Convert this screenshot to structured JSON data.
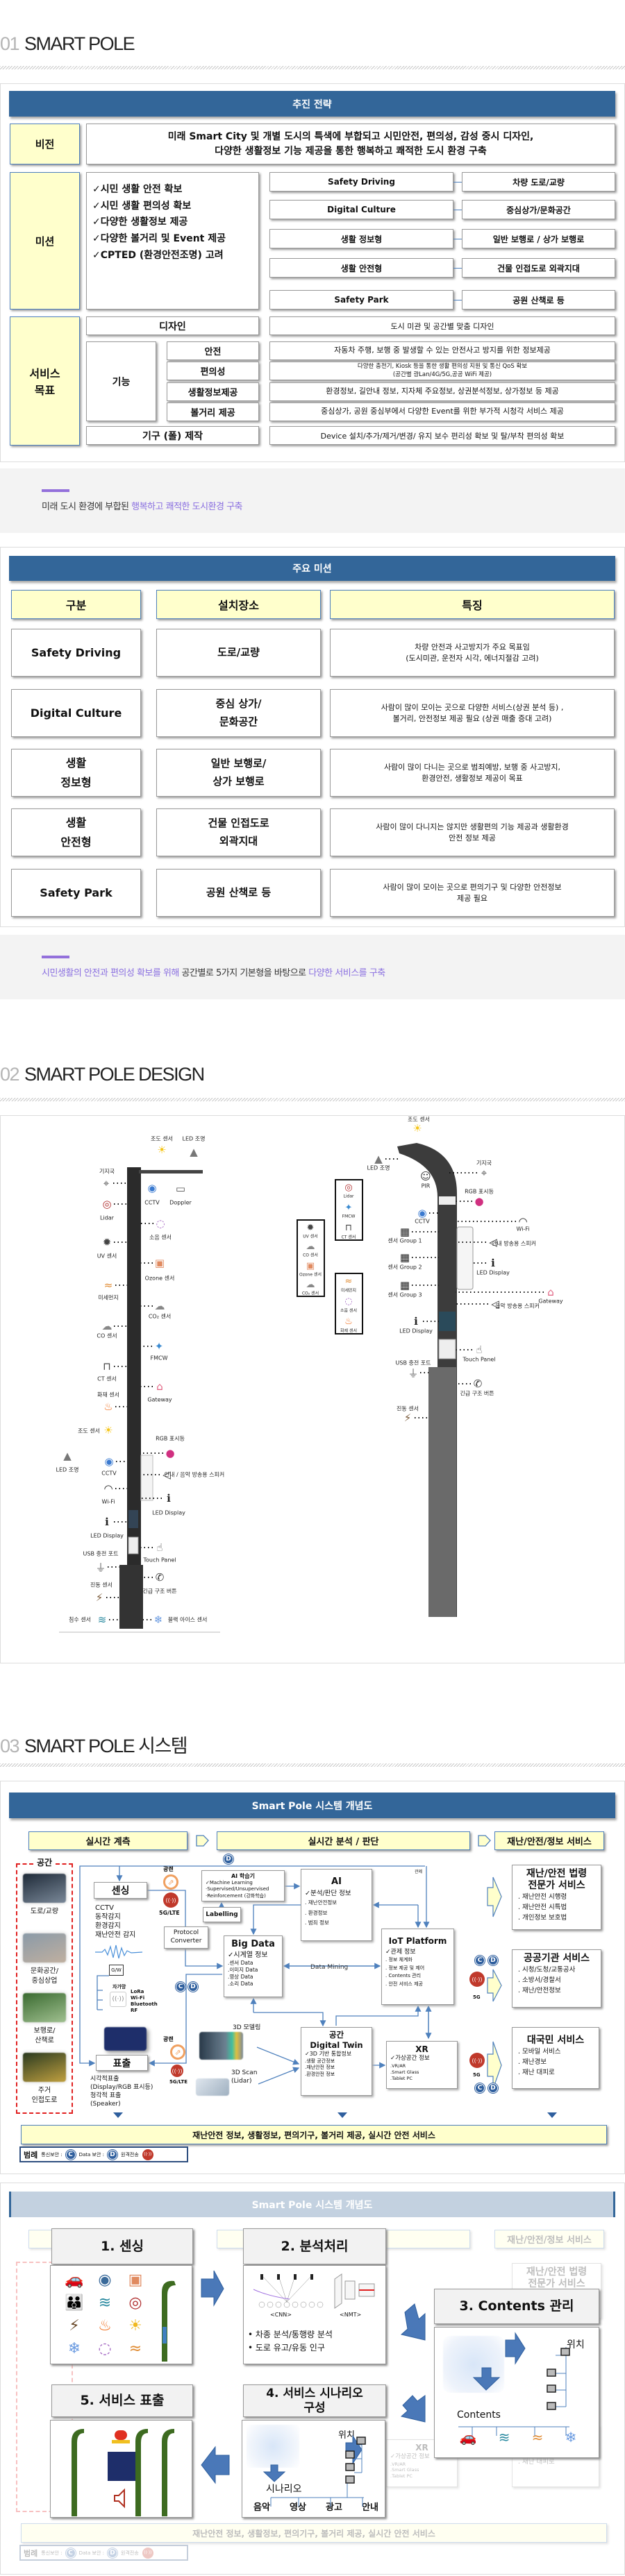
{
  "section1": {
    "num": "01",
    "title": "SMART POLE",
    "strategy": {
      "header": "추진 전략",
      "vision_label": "비전",
      "vision_text": "미래 Smart City 및 개별 도시의 특색에 부합되고 시민안전, 편의성,  감성 중시 디자인,\n다양한 생활정보 기능 제공을 통한 행복하고 쾌적한 도시 환경 구축",
      "mission_label": "미션",
      "mission_checks": [
        "✓시민 생활 안전 확보",
        "✓시민 생활 편의성 확보",
        "✓다양한 생활정보 제공",
        "✓다양한 볼거리 및 Event 제공",
        "✓CPTED (환경안전조명) 고려"
      ],
      "mission_types": [
        {
          "type": "Safety Driving",
          "place": "차량 도로/교량"
        },
        {
          "type": "Digital Culture",
          "place": "중심상가/문화공간"
        },
        {
          "type": "생활 정보형",
          "place": "일반 보행로 / 상가 보행로"
        },
        {
          "type": "생활 안전형",
          "place": "건물 인접도로 외곽지대"
        },
        {
          "type": "Safety Park",
          "place": "공원 산책로 등"
        }
      ],
      "service_label": "서비스\n목표",
      "design_label": "디자인",
      "design_text": "도시 미관 및 공간별 맞춤 디자인",
      "function_label": "기능",
      "functions": [
        {
          "name": "안전",
          "desc": "자동차 주행, 보행 중 발생할 수 있는 안전사고 방지를 위한 정보제공"
        },
        {
          "name": "편의성",
          "desc": "다양한 충전기, Kiosk 등을 통한 생활 편의성 지원 및 통신 QoS 확보\n(공간별 광Lan/4G/5G,공공 WiFi 제공)"
        },
        {
          "name": "생활정보제공",
          "desc": "환경정보, 길안내 정보, 지자체 주요정보, 상권분석정보, 상가정보 등 제공"
        },
        {
          "name": "볼거리 제공",
          "desc": "중심상가, 공원 중심부에서 다양한 Event를 위한 부가적 시청각 서비스 제공"
        }
      ],
      "fixture_label": "기구 (폴) 제작",
      "fixture_text": "Device 설치/추가/제거/변경/ 유지 보수 편리성 확보 및 탈/부착 편의성 확보"
    },
    "caption1": {
      "plain": "미래 도시 환경에 부합된 ",
      "highlight": "행복하고 쾌적한 도시환경 구축"
    },
    "missions": {
      "header": "주요 미션",
      "columns": [
        "구분",
        "설치장소",
        "특징"
      ],
      "rows": [
        {
          "type": "Safety Driving",
          "place": "도로/교량",
          "feature": "차량 안전과 사고방지가 주요 목표임\n(도시미관, 운전자 시각, 에너지절감 고려)"
        },
        {
          "type": "Digital Culture",
          "place": "중심 상가/\n문화공간",
          "feature": "사람이 많이 모이는 곳으로 다양한 서비스(상권 분석 등) ,\n볼거리, 안전정보 제공 필요 (상권 매출 증대 고려)"
        },
        {
          "type": "생활\n정보형",
          "place": "일반 보행로/\n상가 보행로",
          "feature": "사람이 많이 다니는 곳으로 범죄예방, 보행 중 사고방지,\n환경안전, 생활정보 제공이 목표"
        },
        {
          "type": "생활\n안전형",
          "place": "건물 인접도로\n외곽지대",
          "feature": "사람이 많이 다니지는 않지만 생활편의 기능 제공과 생활환경\n안전 정보 제공"
        },
        {
          "type": "Safety Park",
          "place": "공원 산책로 등",
          "feature": "사람이 많이 모이는 곳으로 편의기구 및 다양한 안전정보\n제공 필요"
        }
      ]
    },
    "caption2": {
      "h1": "시민생활의 안전과 편의성 확보를 위해",
      "plain": " 공간별로 5가지 기본형을 바탕으로 ",
      "h2": "다양한 서비스를 구축"
    }
  },
  "section2": {
    "num": "02",
    "title": "SMART POLE DESIGN",
    "left_labels": [
      "조도 센서",
      "LED 조명",
      "기지국",
      "CCTV",
      "Doppler",
      "Lidar",
      "소음 센서",
      "UV 센서",
      "Ozone 센서",
      "미세먼지",
      "CO₂ 센서",
      "CO 센서",
      "FMCW",
      "CT 센서",
      "Gateway",
      "화재 센서",
      "조도 센서",
      "RGB 표시등",
      "LED 조명",
      "CCTV",
      "안내 / 음악 방송용 스피커",
      "Wi-Fi",
      "LED Display",
      "LED Display",
      "Touch Panel",
      "USB 충전 포트",
      "긴급 구조 버튼",
      "진동 센서",
      "침수 센서",
      "블랙 아이스 센서"
    ],
    "right_labels": [
      "조도 센서",
      "LED 조명",
      "기지국",
      "PIR",
      "RGB 표시등",
      "CCTV",
      "Wi-Fi",
      "센서 Group 1",
      "안내 방송용 스피커",
      "센서 Group 2",
      "LED Display",
      "센서 Group 3",
      "Gateway",
      "음악 방송용 스피커",
      "LED Display",
      "Touch Panel",
      "USB 충전 포트",
      "긴급 구조 버튼",
      "진동 센서"
    ],
    "group_boxes": [
      [
        "Lidar",
        "FMCW",
        "CT 센서"
      ],
      [
        "UV 센서",
        "CO 센서",
        "Ozone 센서",
        "CO₂ 센서"
      ],
      [
        "미세먼지",
        "소음 센서",
        "화재 센서"
      ]
    ]
  },
  "section3": {
    "num": "03",
    "title": "SMART POLE 시스템",
    "diagram": {
      "header": "Smart Pole 시스템 개념도",
      "phases": [
        "실시간 계측",
        "실시간 분석 / 판단",
        "재난/안전/정보 서비스"
      ],
      "space_label": "공간",
      "spaces": [
        "도로/교량",
        "문화공간/\n중심상업",
        "보행로/\n산책로",
        "주거\n인접도로"
      ],
      "sensing": {
        "title": "센싱",
        "lines": "CCTV\n동작감지\n환경감지\n재난안전 감지",
        "gw": "G/W",
        "private_net": "자가망",
        "nets": "LoRa\nWi-Fi\nBluetooth\nRF"
      },
      "fiber": "광랜",
      "lte": "5G/LTE",
      "fiveg": "5G",
      "protocol": "Protocol\nConverter",
      "ai_learner": {
        "title": "AI 학습기",
        "lines": "✓Machine Learning\n  ·Supervised/Unsupervised\n  ·Reinforcement (강화학습)"
      },
      "labelling": "Labelling",
      "bigdata": {
        "title": "Big Data",
        "check": "✓시계열 정보",
        "lines": ".센서 Data\n.이미지 Data\n.영상 Data\n.소리 Data"
      },
      "ai": {
        "title": "AI",
        "check": "✓분석/판단 정보",
        "lines": ". 재난안전정보\n. 환경정보\n. 범죄 정보"
      },
      "control": "관제",
      "data_mining": "Data Mining",
      "iot": {
        "title": "IoT Platform",
        "check": "✓관제 정보",
        "lines": ". 정보 체계화\n. 정보 제공 및 제어\n. Contents 관리\n. 안전 서비스 제공"
      },
      "modeling": "3D 모델링",
      "scan": "3D Scan\n(Lidar)",
      "twin": {
        "title": "공간\nDigital Twin",
        "check": "✓3D 기반 통합정보",
        "lines": ".생활 공간정보\n.재난안전 정보\n.환경안전 정보"
      },
      "xr": {
        "title": "XR",
        "check": "✓가상공간 정보",
        "lines": ".VR/AR\n.Smart Glass\n.Tablet PC"
      },
      "display": {
        "title": "표출",
        "lines": "시각적표출\n(Display/RGB 표시등)\n청각적 표출\n(Speaker)"
      },
      "services": [
        {
          "title": "재난/안전 법령\n전문가 서비스",
          "lines": ". 재난안전 시행령\n. 재난안전 시특법\n. 개인정보 보호법"
        },
        {
          "title": "공공기관 서비스",
          "lines": ". 시청/도청/교통공사\n. 소방서/경찰서\n. 재난/안전정보"
        },
        {
          "title": "대국민 서비스",
          "lines": ". 모바일 서비스\n. 재난경보\n. 재난 대피로"
        }
      ],
      "bottom": "재난안전 정보, 생활정보, 편의기구, 볼거리 제공, 실시간 안전 서비스",
      "legend": {
        "title": "범례",
        "comm": "통신보안 :",
        "data": "Data 보안 :",
        "remote": "원격전송"
      },
      "c": "C",
      "d": "D",
      "radio": "((·))"
    },
    "steps": {
      "titles": [
        "1. 센싱",
        "2. 분석처리",
        "3. Contents 관리",
        "4. 서비스 시나리오\n구성",
        "5. 서비스 표출"
      ],
      "cnn": "<CNN>",
      "nmt": "<NMT>",
      "bullets": [
        "•   차종 분석/통행량 분석",
        "•   도로 유고/유동 인구"
      ],
      "location": "위치",
      "contents": "Contents",
      "scenario": "시나리오",
      "scenario_items": [
        "음악",
        "영상",
        "광고",
        "안내"
      ]
    }
  },
  "colors": {
    "header_blue": "#336699",
    "yellow": "#ffffcc",
    "accent_purple": "#8a6fe0",
    "line_blue": "#4f81bd",
    "red": "#c0392b"
  }
}
